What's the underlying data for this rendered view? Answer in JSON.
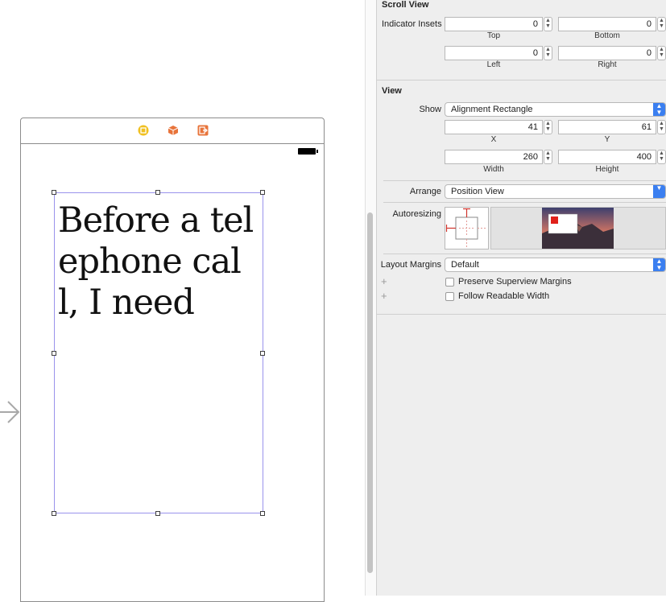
{
  "inspector": {
    "scroll_view": {
      "title": "Scroll View",
      "indicator_insets_label": "Indicator Insets",
      "top_value": "0",
      "bottom_value": "0",
      "left_value": "0",
      "right_value": "0",
      "top_label": "Top",
      "bottom_label": "Bottom",
      "left_label": "Left",
      "right_label": "Right"
    },
    "view": {
      "title": "View",
      "show_label": "Show",
      "show_value": "Alignment Rectangle",
      "x_value": "41",
      "y_value": "61",
      "x_label": "X",
      "y_label": "Y",
      "width_value": "260",
      "height_value": "400",
      "width_label": "Width",
      "height_label": "Height",
      "arrange_label": "Arrange",
      "arrange_value": "Position View",
      "autoresizing_label": "Autoresizing",
      "layout_margins_label": "Layout Margins",
      "layout_margins_value": "Default",
      "preserve_label": "Preserve Superview Margins",
      "preserve_checked": false,
      "readable_label": "Follow Readable Width",
      "readable_checked": false
    }
  },
  "canvas": {
    "text_view_content": "Before a telephone call, I need",
    "scene_dock_icons": [
      "view-controller-icon",
      "first-responder-icon",
      "exit-icon"
    ]
  },
  "colors": {
    "accent": "#3b7ff0",
    "selection": "#9a93ec",
    "dock_yellow": "#f0c020",
    "dock_orange": "#e8743b",
    "autoresize_red": "#d0332c"
  }
}
